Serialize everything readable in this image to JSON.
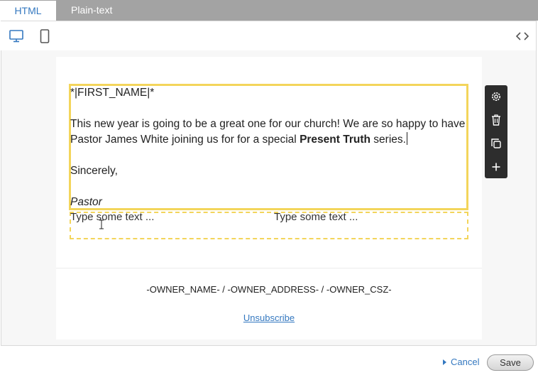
{
  "tabs": {
    "html_label": "HTML",
    "plaintext_label": "Plain-text"
  },
  "toolbar": {
    "icons": [
      "desktop-icon",
      "mobile-icon",
      "code-icon"
    ],
    "active": "desktop"
  },
  "email": {
    "merge_tag": "*|FIRST_NAME|*",
    "body_part1": "This new year is going to be a great one for our church! We are so happy to have Pastor James White joining us for for a special ",
    "body_bold": "Present Truth",
    "body_part2": " series.",
    "closing": "Sincerely,",
    "signature": "Pastor",
    "column_placeholder_1": "Type some text ...",
    "column_placeholder_2": "Type some text ..."
  },
  "block_tools": {
    "icons": [
      "gear-icon",
      "trash-icon",
      "duplicate-icon",
      "plus-icon"
    ]
  },
  "footer": {
    "address": "-OWNER_NAME- / -OWNER_ADDRESS- / -OWNER_CSZ-",
    "unsubscribe": "Unsubscribe"
  },
  "actions": {
    "cancel": "Cancel",
    "save": "Save"
  },
  "colors": {
    "accent": "#3478c0",
    "selection": "#f3d55b",
    "tab_bar": "#a3a3a3",
    "tool_panel": "#2d2d2d"
  }
}
